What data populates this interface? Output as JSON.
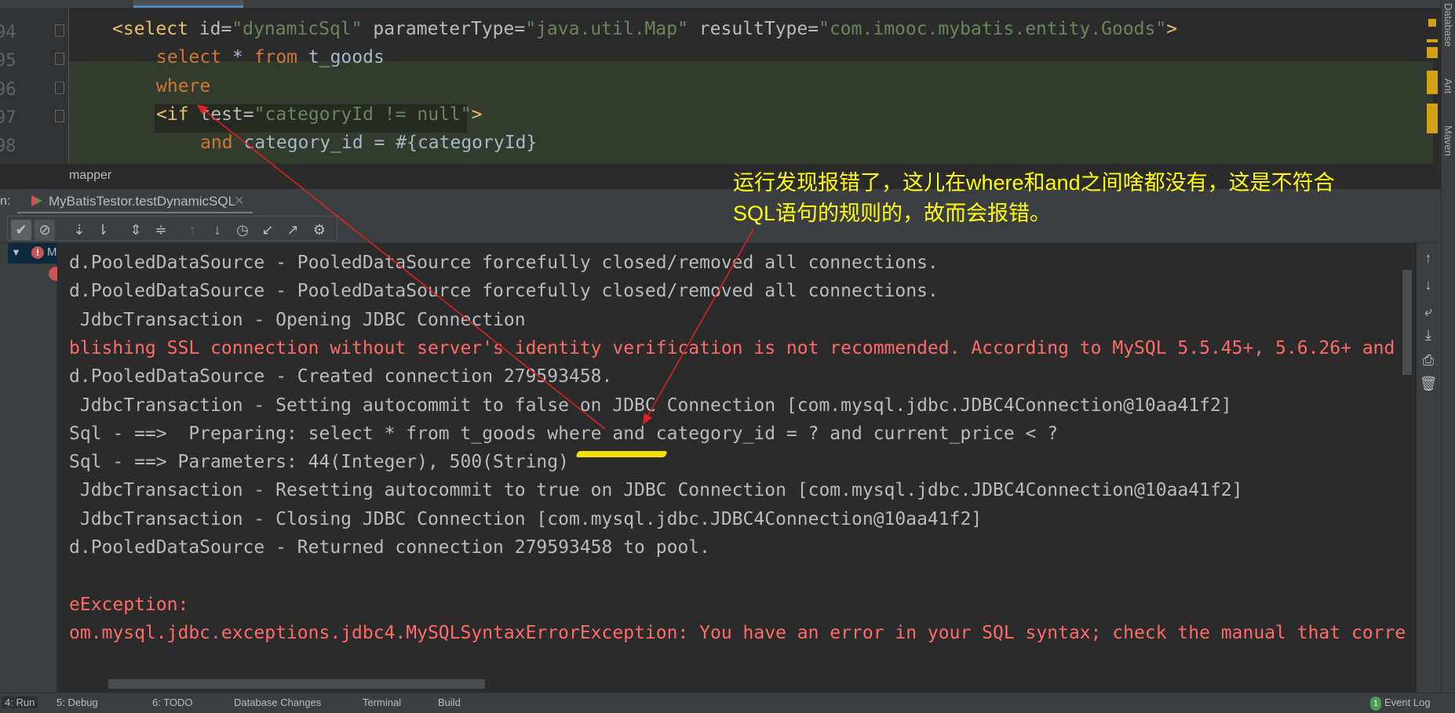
{
  "editor": {
    "line_numbers": [
      "94",
      "95",
      "96",
      "97",
      "98"
    ],
    "lines": {
      "l94": {
        "open": "<select ",
        "id_attr": "id=",
        "id_val": "\"dynamicSql\"",
        "pt_attr": " parameterType=",
        "pt_val": "\"java.util.Map\"",
        "rt_attr": " resultType=",
        "rt_val": "\"com.imooc.mybatis.entity.Goods\"",
        "close": ">"
      },
      "l95": {
        "kw1": "select",
        "star": " * ",
        "kw2": "from",
        "rest": " t_goods"
      },
      "l96": {
        "kw": "where"
      },
      "l97": {
        "open": "<if ",
        "attr": "test=",
        "val": "\"categoryId != null\"",
        "close": ">"
      },
      "l98": {
        "kw": "and",
        "rest": " category_id = #{categoryId}"
      }
    },
    "breadcrumb": "mapper"
  },
  "run_panel": {
    "label": "n:",
    "tab_title": "MyBatisTestor.testDynamicSQL",
    "tree_item": "M"
  },
  "console": {
    "lines": [
      {
        "text": "d.PooledDataSource - PooledDataSource forcefully closed/removed all connections.",
        "error": false
      },
      {
        "text": "d.PooledDataSource - PooledDataSource forcefully closed/removed all connections.",
        "error": false
      },
      {
        "text": " JdbcTransaction - Opening JDBC Connection",
        "error": false
      },
      {
        "text": "blishing SSL connection without server's identity verification is not recommended. According to MySQL 5.5.45+, 5.6.26+ and",
        "error": true
      },
      {
        "text": "d.PooledDataSource - Created connection 279593458.",
        "error": false
      },
      {
        "text": " JdbcTransaction - Setting autocommit to false on JDBC Connection [com.mysql.jdbc.JDBC4Connection@10aa41f2]",
        "error": false
      },
      {
        "text": "Sql - ==>  Preparing: select * from t_goods where and category_id = ? and current_price < ?",
        "error": false
      },
      {
        "text": "Sql - ==> Parameters: 44(Integer), 500(String)",
        "error": false
      },
      {
        "text": " JdbcTransaction - Resetting autocommit to true on JDBC Connection [com.mysql.jdbc.JDBC4Connection@10aa41f2]",
        "error": false
      },
      {
        "text": " JdbcTransaction - Closing JDBC Connection [com.mysql.jdbc.JDBC4Connection@10aa41f2]",
        "error": false
      },
      {
        "text": "d.PooledDataSource - Returned connection 279593458 to pool.",
        "error": false
      },
      {
        "text": "",
        "error": false
      },
      {
        "text": "eException:",
        "error": true
      },
      {
        "text": "om.mysql.jdbc.exceptions.jdbc4.MySQLSyntaxErrorException: You have an error in your SQL syntax; check the manual that corre",
        "error": true
      }
    ]
  },
  "annotation": {
    "line1": "运行发现报错了，这儿在where和and之间啥都没有，这是不符合",
    "line2": "SQL语句的规则的，故而会报错。",
    "color": "#ffff00",
    "arrow_color": "#e02020"
  },
  "right_strip": [
    "Database",
    "Ant",
    "Maven"
  ],
  "status_bar": {
    "items": [
      "4: Run",
      "5: Debug",
      "6: TODO",
      "Database Changes",
      "Terminal",
      "Build"
    ],
    "event_log": "Event Log",
    "event_count": "1"
  },
  "colors": {
    "error": "#ff6b68",
    "console_text": "#bbbbbb",
    "tag": "#e8bf6a",
    "string": "#6a8759",
    "keyword": "#cc7832"
  }
}
